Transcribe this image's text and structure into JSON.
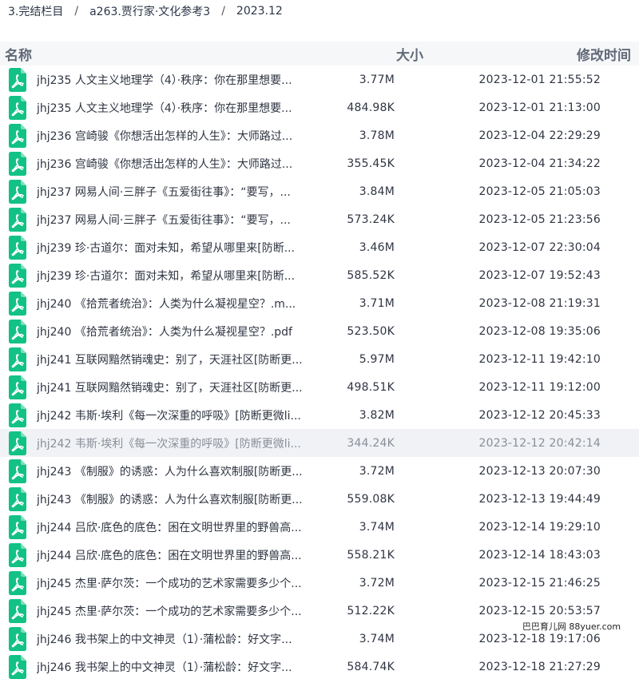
{
  "breadcrumb": [
    "3.完结栏目",
    "/",
    "a263.贾行家·文化参考3",
    "/",
    "2023.12"
  ],
  "header": {
    "name": "名称",
    "size": "大小",
    "time": "修改时间"
  },
  "colors": {
    "pdf_icon": "#12c285",
    "header_bg": "#f6f7f9",
    "hover_row": "#f0f2f5"
  },
  "watermark": "巴巴育儿网 88yuer.com",
  "hover_row_index": 13,
  "files": [
    {
      "name": "jhj235 人文主义地理学（4）·秩序：你在那里想要...",
      "size": "3.77M",
      "time": "2023-12-01 21:55:52"
    },
    {
      "name": "jhj235 人文主义地理学（4）·秩序：你在那里想要...",
      "size": "484.98K",
      "time": "2023-12-01 21:13:00"
    },
    {
      "name": "jhj236 宫崎骏《你想活出怎样的人生》：大师路过...",
      "size": "3.78M",
      "time": "2023-12-04 22:29:29"
    },
    {
      "name": "jhj236 宫崎骏《你想活出怎样的人生》：大师路过...",
      "size": "355.45K",
      "time": "2023-12-04 21:34:22"
    },
    {
      "name": "jhj237 网易人间·三胖子《五爱街往事》：“要写，...",
      "size": "3.84M",
      "time": "2023-12-05 21:05:03"
    },
    {
      "name": "jhj237 网易人间·三胖子《五爱街往事》：“要写，...",
      "size": "573.24K",
      "time": "2023-12-05 21:23:56"
    },
    {
      "name": "jhj239 珍·古道尔：面对未知，希望从哪里来[防断...",
      "size": "3.46M",
      "time": "2023-12-07 22:30:04"
    },
    {
      "name": "jhj239 珍·古道尔：面对未知，希望从哪里来[防断...",
      "size": "585.52K",
      "time": "2023-12-07 19:52:43"
    },
    {
      "name": "jhj240 《拾荒者统治》：人类为什么凝视星空？.m...",
      "size": "3.71M",
      "time": "2023-12-08 21:19:31"
    },
    {
      "name": "jhj240 《拾荒者统治》：人类为什么凝视星空？.pdf",
      "size": "523.50K",
      "time": "2023-12-08 19:35:06"
    },
    {
      "name": "jhj241 互联网黯然销魂史：别了，天涯社区[防断更...",
      "size": "5.97M",
      "time": "2023-12-11 19:42:10"
    },
    {
      "name": "jhj241 互联网黯然销魂史：别了，天涯社区[防断更...",
      "size": "498.51K",
      "time": "2023-12-11 19:12:00"
    },
    {
      "name": "jhj242 韦斯·埃利《每一次深重的呼吸》[防断更微li...",
      "size": "3.82M",
      "time": "2023-12-12 20:45:33"
    },
    {
      "name": "jhj242 韦斯·埃利《每一次深重的呼吸》[防断更微li...",
      "size": "344.24K",
      "time": "2023-12-12 20:42:14"
    },
    {
      "name": "jhj243 《制服》的诱惑：人为什么喜欢制服[防断更...",
      "size": "3.72M",
      "time": "2023-12-13 20:07:30"
    },
    {
      "name": "jhj243 《制服》的诱惑：人为什么喜欢制服[防断更...",
      "size": "559.08K",
      "time": "2023-12-13 19:44:49"
    },
    {
      "name": "jhj244 吕欣·底色的底色：困在文明世界里的野兽高...",
      "size": "3.74M",
      "time": "2023-12-14 19:29:10"
    },
    {
      "name": "jhj244 吕欣·底色的底色：困在文明世界里的野兽高...",
      "size": "558.21K",
      "time": "2023-12-14 18:43:03"
    },
    {
      "name": "jhj245 杰里·萨尔茨：一个成功的艺术家需要多少个...",
      "size": "3.72M",
      "time": "2023-12-15 21:46:25"
    },
    {
      "name": "jhj245 杰里·萨尔茨：一个成功的艺术家需要多少个...",
      "size": "512.22K",
      "time": "2023-12-15 20:53:57"
    },
    {
      "name": "jhj246 我书架上的中文神灵（1）·蒲松龄：好文字...",
      "size": "3.74M",
      "time": "2023-12-18 19:17:06"
    },
    {
      "name": "jhj246 我书架上的中文神灵（1）·蒲松龄：好文字...",
      "size": "584.74K",
      "time": "2023-12-18 21:27:29"
    }
  ]
}
